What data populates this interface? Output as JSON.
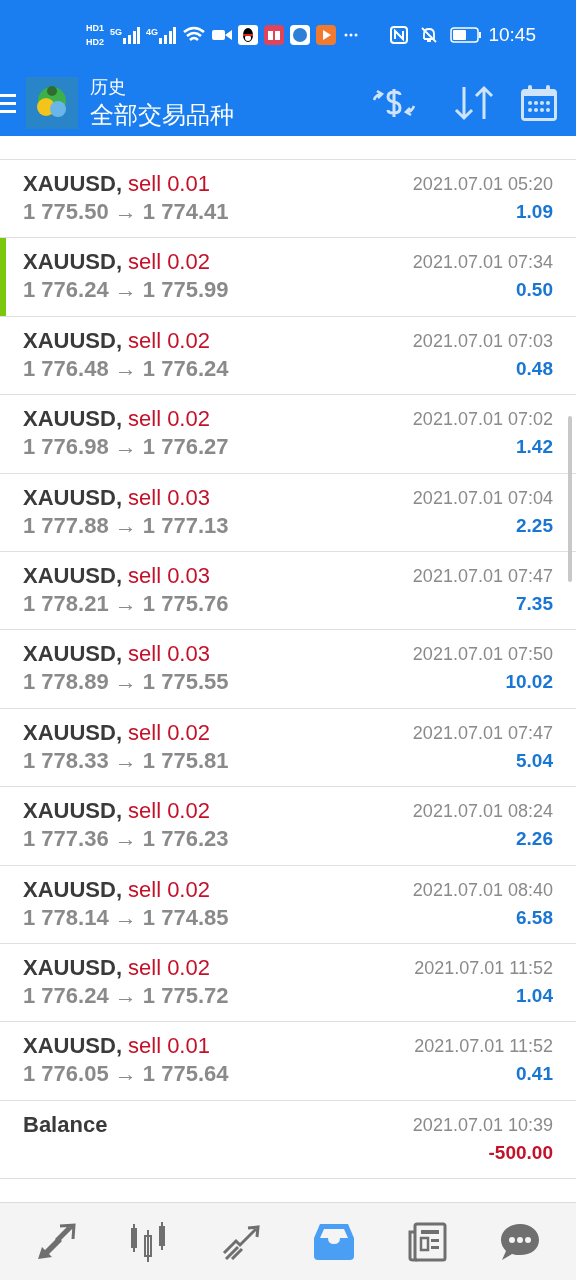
{
  "status_bar": {
    "sim_labels": [
      "HD1",
      "HD2"
    ],
    "networks": [
      "5G",
      "4G"
    ],
    "time": "10:45"
  },
  "header": {
    "title": "历史",
    "subtitle": "全部交易品种"
  },
  "rows": [
    {
      "kind": "trade",
      "symbol": "XAUUSD,",
      "side": "sell 0.01",
      "prices": "1 775.50 → 1 774.41",
      "time": "2021.07.01 05:20",
      "profit": "1.09",
      "negative": false,
      "marked": false
    },
    {
      "kind": "trade",
      "symbol": "XAUUSD,",
      "side": "sell 0.02",
      "prices": "1 776.24 → 1 775.99",
      "time": "2021.07.01 07:34",
      "profit": "0.50",
      "negative": false,
      "marked": true
    },
    {
      "kind": "trade",
      "symbol": "XAUUSD,",
      "side": "sell 0.02",
      "prices": "1 776.48 → 1 776.24",
      "time": "2021.07.01 07:03",
      "profit": "0.48",
      "negative": false,
      "marked": false
    },
    {
      "kind": "trade",
      "symbol": "XAUUSD,",
      "side": "sell 0.02",
      "prices": "1 776.98 → 1 776.27",
      "time": "2021.07.01 07:02",
      "profit": "1.42",
      "negative": false,
      "marked": false
    },
    {
      "kind": "trade",
      "symbol": "XAUUSD,",
      "side": "sell 0.03",
      "prices": "1 777.88 → 1 777.13",
      "time": "2021.07.01 07:04",
      "profit": "2.25",
      "negative": false,
      "marked": false
    },
    {
      "kind": "trade",
      "symbol": "XAUUSD,",
      "side": "sell 0.03",
      "prices": "1 778.21 → 1 775.76",
      "time": "2021.07.01 07:47",
      "profit": "7.35",
      "negative": false,
      "marked": false
    },
    {
      "kind": "trade",
      "symbol": "XAUUSD,",
      "side": "sell 0.03",
      "prices": "1 778.89 → 1 775.55",
      "time": "2021.07.01 07:50",
      "profit": "10.02",
      "negative": false,
      "marked": false
    },
    {
      "kind": "trade",
      "symbol": "XAUUSD,",
      "side": "sell 0.02",
      "prices": "1 778.33 → 1 775.81",
      "time": "2021.07.01 07:47",
      "profit": "5.04",
      "negative": false,
      "marked": false
    },
    {
      "kind": "trade",
      "symbol": "XAUUSD,",
      "side": "sell 0.02",
      "prices": "1 777.36 → 1 776.23",
      "time": "2021.07.01 08:24",
      "profit": "2.26",
      "negative": false,
      "marked": false
    },
    {
      "kind": "trade",
      "symbol": "XAUUSD,",
      "side": "sell 0.02",
      "prices": "1 778.14 → 1 774.85",
      "time": "2021.07.01 08:40",
      "profit": "6.58",
      "negative": false,
      "marked": false
    },
    {
      "kind": "trade",
      "symbol": "XAUUSD,",
      "side": "sell 0.02",
      "prices": "1 776.24 → 1 775.72",
      "time": "2021.07.01 11:52",
      "profit": "1.04",
      "negative": false,
      "marked": false
    },
    {
      "kind": "trade",
      "symbol": "XAUUSD,",
      "side": "sell 0.01",
      "prices": "1 776.05 → 1 775.64",
      "time": "2021.07.01 11:52",
      "profit": "0.41",
      "negative": false,
      "marked": false
    },
    {
      "kind": "balance",
      "symbol": "Balance",
      "time": "2021.07.01 10:39",
      "profit": "-500.00",
      "negative": true,
      "marked": false
    }
  ],
  "bottom_nav": [
    {
      "selected": false
    },
    {
      "selected": false
    },
    {
      "selected": false
    },
    {
      "selected": true
    },
    {
      "selected": false
    },
    {
      "selected": false
    }
  ]
}
